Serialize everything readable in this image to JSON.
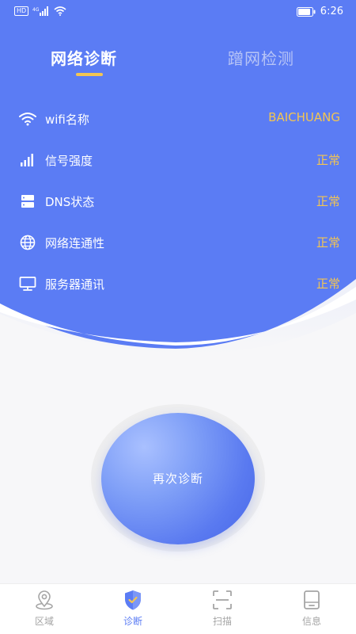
{
  "status_bar": {
    "time": "6:26",
    "hd": "HD",
    "network": "4G"
  },
  "tabs": [
    {
      "label": "网络诊断",
      "active": true
    },
    {
      "label": "蹭网检测",
      "active": false
    }
  ],
  "diagnostics": [
    {
      "icon": "wifi-icon",
      "label": "wifi名称",
      "value": "BAICHUANG"
    },
    {
      "icon": "signal-bars-icon",
      "label": "信号强度",
      "value": "正常"
    },
    {
      "icon": "server-icon",
      "label": "DNS状态",
      "value": "正常"
    },
    {
      "icon": "globe-icon",
      "label": "网络连通性",
      "value": "正常"
    },
    {
      "icon": "monitor-icon",
      "label": "服务器通讯",
      "value": "正常"
    }
  ],
  "diagnose_button": {
    "label": "再次诊断"
  },
  "bottom_nav": [
    {
      "icon": "location-pin-icon",
      "label": "区域",
      "active": false
    },
    {
      "icon": "shield-check-icon",
      "label": "诊断",
      "active": true
    },
    {
      "icon": "scan-icon",
      "label": "扫描",
      "active": false
    },
    {
      "icon": "device-icon",
      "label": "信息",
      "active": false
    }
  ],
  "colors": {
    "primary": "#5b7cf4",
    "accent": "#f3c552",
    "inactive_tab": "#b7c4f6",
    "nav_inactive": "#a5a5a5"
  }
}
